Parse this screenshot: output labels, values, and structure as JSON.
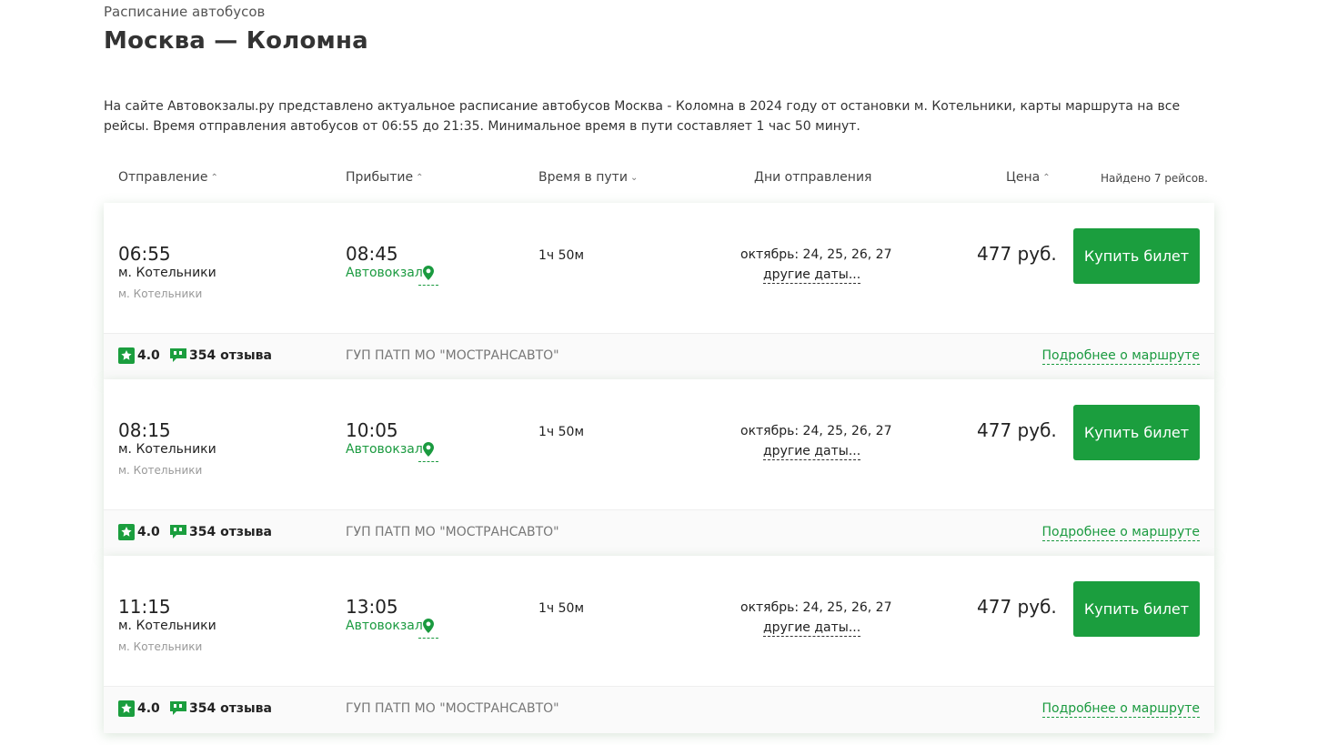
{
  "breadcrumb": "Расписание автобусов",
  "title": "Москва — Коломна",
  "intro": "На сайте Автовокзалы.ру представлено актуальное расписание автобусов Москва - Коломна в 2024 году от остановки м. Котельники, карты маршрута на все рейсы. Время отправления автобусов от 06:55 до 21:35. Минимальное время в пути составляет 1 час 50 минут.",
  "table_header": {
    "departure": "Отправление",
    "arrival": "Прибытие",
    "duration": "Время в пути",
    "days": "Дни отправления",
    "price": "Цена",
    "found": "Найдено 7 рейсов."
  },
  "colors": {
    "accent": "#1b9e3e",
    "link": "#1a9a3f"
  },
  "trips": [
    {
      "dep_time": "06:55",
      "dep_station": "м. Котельники",
      "dep_sub": "м. Котельники",
      "arr_time": "08:45",
      "arr_station": "Автовокзал",
      "duration": "1ч 50м",
      "days": "октябрь: 24, 25, 26, 27",
      "other_dates": "другие даты...",
      "price": "477 руб.",
      "buy_label": "Купить билет",
      "rating": "4.0",
      "reviews": "354 отзыва",
      "carrier": "ГУП ПАТП МО \"МОСТРАНСАВТО\"",
      "details_link": "Подробнее о маршруте"
    },
    {
      "dep_time": "08:15",
      "dep_station": "м. Котельники",
      "dep_sub": "м. Котельники",
      "arr_time": "10:05",
      "arr_station": "Автовокзал",
      "duration": "1ч 50м",
      "days": "октябрь: 24, 25, 26, 27",
      "other_dates": "другие даты...",
      "price": "477 руб.",
      "buy_label": "Купить билет",
      "rating": "4.0",
      "reviews": "354 отзыва",
      "carrier": "ГУП ПАТП МО \"МОСТРАНСАВТО\"",
      "details_link": "Подробнее о маршруте"
    },
    {
      "dep_time": "11:15",
      "dep_station": "м. Котельники",
      "dep_sub": "м. Котельники",
      "arr_time": "13:05",
      "arr_station": "Автовокзал",
      "duration": "1ч 50м",
      "days": "октябрь: 24, 25, 26, 27",
      "other_dates": "другие даты...",
      "price": "477 руб.",
      "buy_label": "Купить билет",
      "rating": "4.0",
      "reviews": "354 отзыва",
      "carrier": "ГУП ПАТП МО \"МОСТРАНСАВТО\"",
      "details_link": "Подробнее о маршруте"
    }
  ]
}
